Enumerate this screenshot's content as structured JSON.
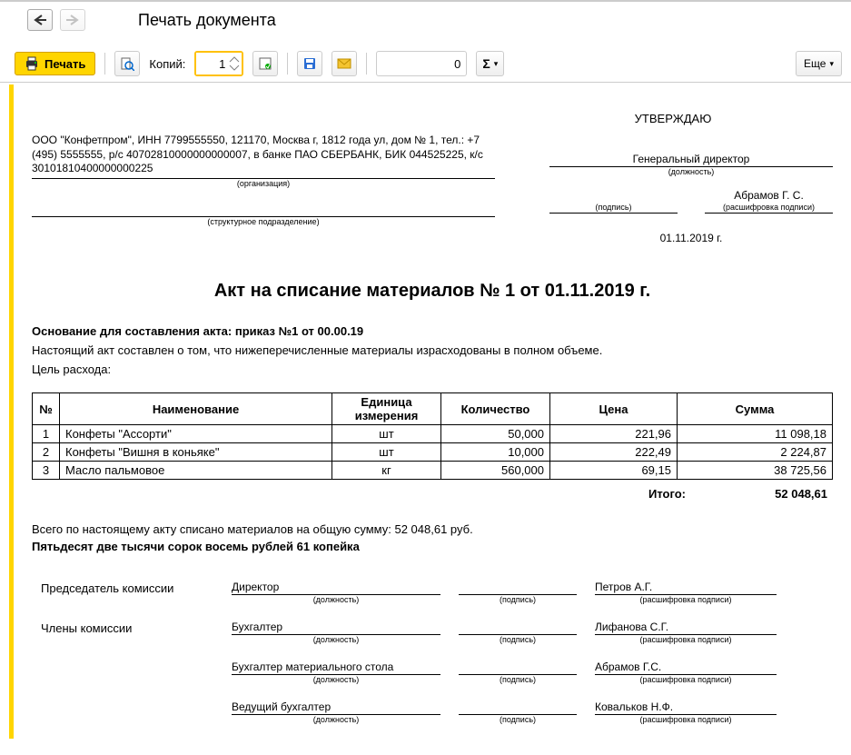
{
  "header": {
    "title": "Печать документа"
  },
  "toolbar": {
    "print_label": "Печать",
    "copies_label": "Копий:",
    "copies_value": "1",
    "num_value": "0",
    "more_label": "Еще"
  },
  "document": {
    "approve": {
      "title": "УТВЕРЖДАЮ",
      "position": "Генеральный директор",
      "sub_position": "(должность)",
      "sub_sign": "(подпись)",
      "name": "Абрамов Г. С.",
      "sub_name": "(расшифровка подписи)",
      "date": "01.11.2019 г."
    },
    "org": {
      "text": "ООО \"Конфетпром\", ИНН 7799555550, 121170, Москва г, 1812 года ул, дом № 1, тел.: +7 (495) 5555555, р/с 40702810000000000007, в банке ПАО СБЕРБАНК, БИК 044525225, к/с 30101810400000000225",
      "sub1": "(организация)",
      "sub2": "(структурное подразделение)"
    },
    "title": "Акт на списание материалов № 1 от 01.11.2019 г.",
    "basis_label": "Основание для составления акта: приказ №1 от 00.00.19",
    "desc1": "Настоящий акт составлен о том, что нижеперечисленные материалы израсходованы в полном объеме.",
    "desc2": "Цель расхода:",
    "columns": [
      "№",
      "Наименование",
      "Единица измерения",
      "Количество",
      "Цена",
      "Сумма"
    ],
    "rows": [
      {
        "n": "1",
        "name": "Конфеты \"Ассорти\"",
        "unit": "шт",
        "qty": "50,000",
        "price": "221,96",
        "sum": "11 098,18"
      },
      {
        "n": "2",
        "name": "Конфеты \"Вишня в коньяке\"",
        "unit": "шт",
        "qty": "10,000",
        "price": "222,49",
        "sum": "2 224,87"
      },
      {
        "n": "3",
        "name": "Масло пальмовое",
        "unit": "кг",
        "qty": "560,000",
        "price": "69,15",
        "sum": "38 725,56"
      }
    ],
    "total_label": "Итого:",
    "total_value": "52 048,61",
    "summary": "Всего по настоящему акту списано материалов на общую сумму: 52 048,61 руб.",
    "summary_bold": "Пятьдесят две тысячи сорок восемь рублей 61 копейка",
    "commission": {
      "chairman_label": "Председатель комиссии",
      "members_label": "Члены комиссии",
      "sub_pos": "(должность)",
      "sub_sign": "(подпись)",
      "sub_name": "(расшифровка подписи)",
      "lines": [
        {
          "pos": "Директор",
          "name": "Петров А.Г."
        },
        {
          "pos": "Бухгалтер",
          "name": "Лифанова С.Г."
        },
        {
          "pos": "Бухгалтер материального стола",
          "name": "Абрамов Г.С."
        },
        {
          "pos": "Ведущий бухгалтер",
          "name": "Ковальков Н.Ф."
        }
      ]
    }
  }
}
